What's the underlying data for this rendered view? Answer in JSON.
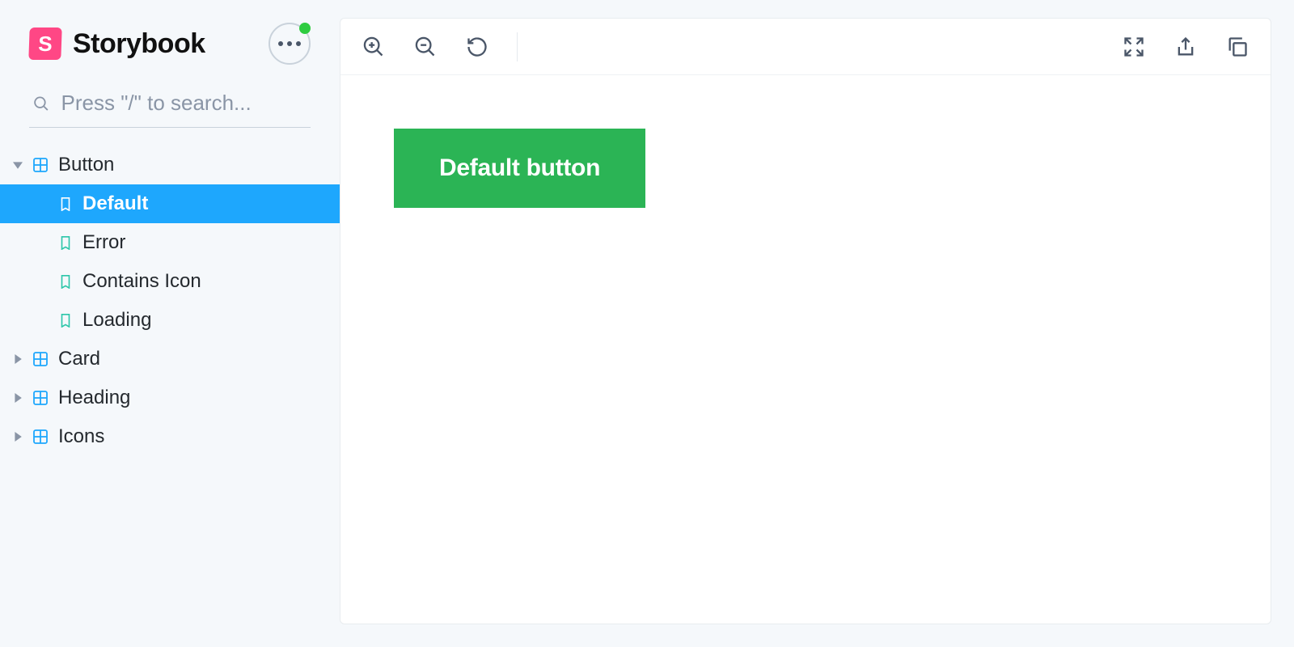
{
  "brand": {
    "logo_letter": "S",
    "name": "Storybook"
  },
  "search": {
    "placeholder": "Press \"/\" to search..."
  },
  "sidebar": {
    "components": [
      {
        "label": "Button",
        "expanded": true,
        "stories": [
          {
            "label": "Default",
            "selected": true
          },
          {
            "label": "Error",
            "selected": false
          },
          {
            "label": "Contains Icon",
            "selected": false
          },
          {
            "label": "Loading",
            "selected": false
          }
        ]
      },
      {
        "label": "Card",
        "expanded": false,
        "stories": []
      },
      {
        "label": "Heading",
        "expanded": false,
        "stories": []
      },
      {
        "label": "Icons",
        "expanded": false,
        "stories": []
      }
    ]
  },
  "toolbar": {
    "left": [
      "zoom-in",
      "zoom-out",
      "reset-zoom"
    ],
    "right": [
      "fullscreen",
      "open-new-window",
      "copy-link"
    ]
  },
  "preview": {
    "button_label": "Default button"
  },
  "colors": {
    "accent": "#1ea7fd",
    "brand": "#ff4785",
    "demo_button": "#2bb455",
    "story_icon": "#2cc6a9"
  }
}
